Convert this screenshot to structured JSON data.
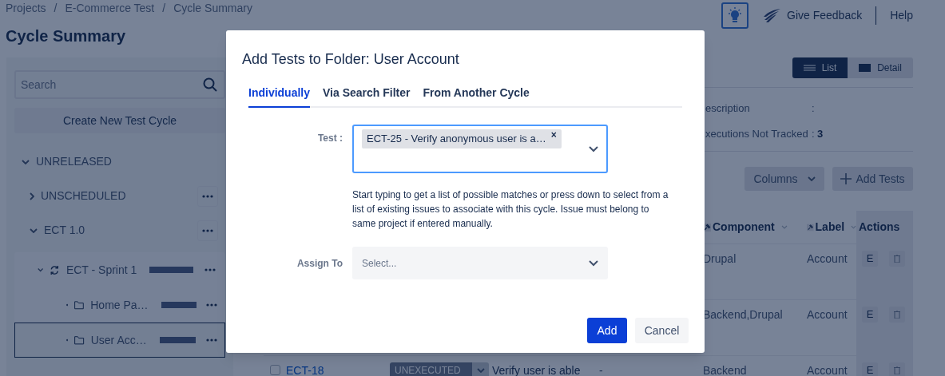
{
  "breadcrumb": {
    "separator": "/",
    "items": [
      "Projects",
      "E-Commerce Test",
      "Cycle Summary"
    ]
  },
  "page_title": "Cycle Summary",
  "header": {
    "feedback": "Give Feedback",
    "help": "Help"
  },
  "sidebar": {
    "search": {
      "placeholder": "Search"
    },
    "create_button": "Create New Test Cycle",
    "tree": [
      {
        "label": "UNRELEASED",
        "kind": "group",
        "expanded": true,
        "selected": false,
        "children": [
          {
            "label": "UNSCHEDULED",
            "kind": "version",
            "expanded": false,
            "selected": false
          },
          {
            "label": "ECT 1.0",
            "kind": "version",
            "expanded": true,
            "selected": false,
            "children": [
              {
                "label": "ECT - Sprint 1",
                "kind": "cycle",
                "expanded": true,
                "selected": false,
                "level": 1,
                "children": [
                  {
                    "label": "Home Pa…",
                    "kind": "folder",
                    "selected": false,
                    "level": 1
                  },
                  {
                    "label": "User Acc…",
                    "kind": "folder",
                    "selected": true,
                    "level": 1
                  }
                ]
              }
            ]
          }
        ]
      }
    ]
  },
  "view_toggle": [
    {
      "label": "List",
      "kind": "list",
      "selected": true
    },
    {
      "label": "Detail",
      "kind": "detail",
      "selected": false
    }
  ],
  "details": [
    {
      "label": "escription",
      "separator": ":"
    },
    {
      "label": "xecutions Not Tracked",
      "separator": ":",
      "value": "3"
    }
  ],
  "toolbar": {
    "columns_button": "Columns",
    "add_button": "Add Tests"
  },
  "table": {
    "columns": [
      {
        "label": "Component",
        "pinned": true,
        "sortable": true
      },
      {
        "label": "Label",
        "pinned": true,
        "sortable": true
      },
      {
        "label": "Actions"
      }
    ],
    "rows": [
      {
        "component": "Drupal",
        "label": "Account",
        "edit": "E"
      },
      {
        "component": "Backend,Drupal",
        "label": "Account",
        "edit": "E"
      },
      {
        "checked": false,
        "id": "ECT-18",
        "status": "UNEXECUTED",
        "summary": "Verify user is able",
        "column_5": "-",
        "component": "Backend",
        "label": "Account",
        "edit": "E"
      }
    ]
  },
  "dialog": {
    "title": "Add Tests to Folder: User Account",
    "tabs": [
      {
        "label": "Individually",
        "selected": true
      },
      {
        "label": "Via Search Filter",
        "selected": false
      },
      {
        "label": "From Another Cycle",
        "selected": false
      }
    ],
    "test_field": {
      "label": "Test :",
      "chips": [
        {
          "text": "ECT-25 - Verify anonymous user is a…",
          "remove": "×"
        }
      ]
    },
    "help_text": "Start typing to get a list of possible matches or press down to select from a list of existing issues to associate with this cycle. Issue must belong to same project if entered manually.",
    "assign_field": {
      "label": "Assign To",
      "placeholder": "Select..."
    },
    "buttons": [
      {
        "label": "Add",
        "kind": "primary"
      },
      {
        "label": "Cancel",
        "kind": "secondary"
      }
    ]
  }
}
